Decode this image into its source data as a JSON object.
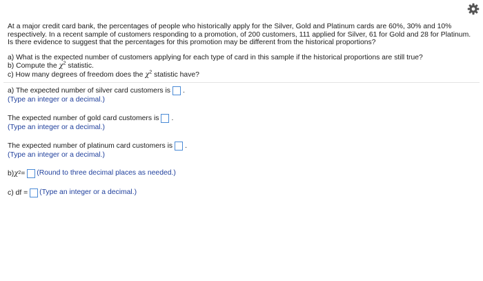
{
  "toolbar": {
    "settings_icon": "gear-icon"
  },
  "problem": {
    "text": "At a major credit card bank, the percentages of people who historically apply for the Silver, Gold and Platinum cards are 60%, 30% and 10% respectively. In a recent sample of customers responding to a promotion, of 200 customers, 111 applied for Silver, 61 for Gold and 28 for Platinum. Is there evidence to suggest that the percentages for this promotion may be different from the historical proportions?",
    "q_a": "a) What is the expected number of customers applying for each type of card in this sample if the historical proportions are still true?",
    "q_b_pre": "b) Compute the ",
    "q_b_post": " statistic.",
    "q_c_pre": "c) How many degrees of freedom does the ",
    "q_c_post": " statistic have?"
  },
  "chi_symbol": "χ",
  "chi_exp": "2",
  "answers": {
    "silver_label": "a) The expected number of silver card customers is",
    "silver_hint": "(Type an integer or a decimal.)",
    "silver_value": "",
    "gold_label": "The expected number of gold card customers is",
    "gold_hint": "(Type an integer or a decimal.)",
    "gold_value": "",
    "platinum_label": "The expected number of platinum card customers is",
    "platinum_hint": "(Type an integer or a decimal.)",
    "platinum_value": "",
    "chi_label_pre": "b) ",
    "chi_label_post": " =",
    "chi_hint": "(Round to three decimal places as needed.)",
    "chi_value": "",
    "df_label": "c) df =",
    "df_hint": "(Type an integer or a decimal.)",
    "df_value": "",
    "period": "."
  }
}
